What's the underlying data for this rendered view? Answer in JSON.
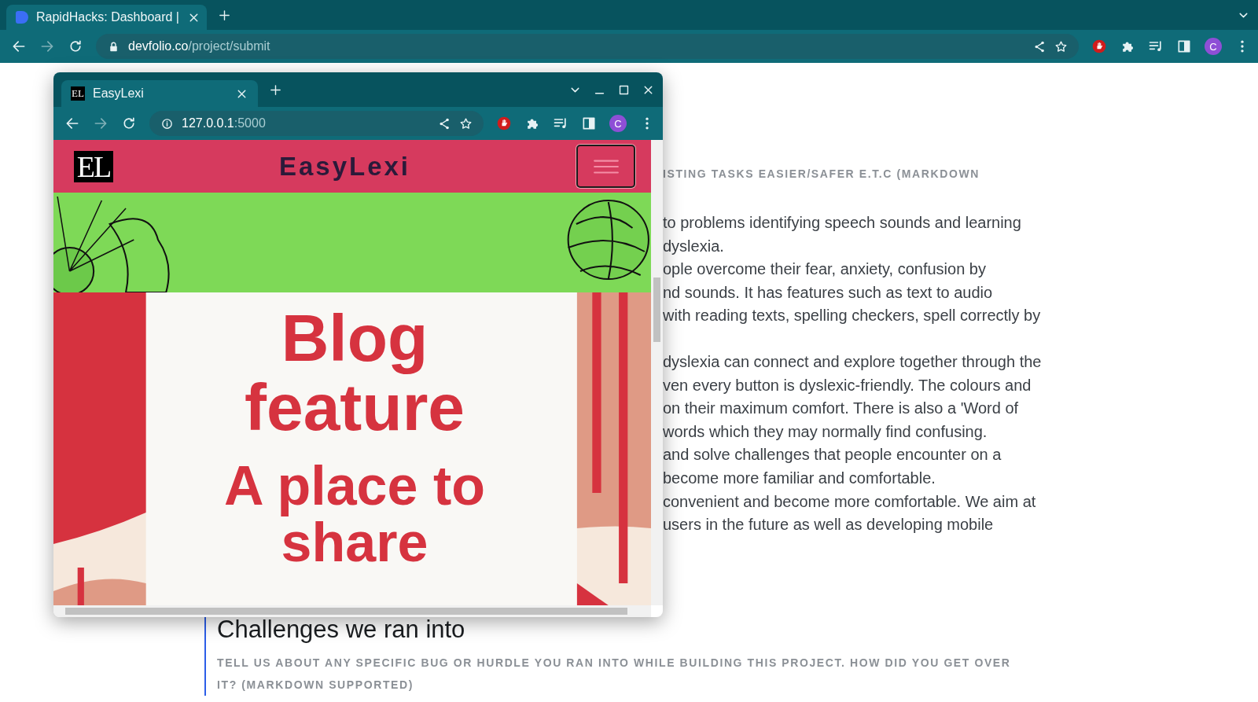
{
  "browser": {
    "tabs": [
      {
        "title": "RapidHacks: Dashboard |",
        "selected": true
      }
    ],
    "url_host": "devfolio.co",
    "url_path": "/project/submit",
    "profile": "C"
  },
  "page": {
    "section_prompt": "ISTING TASKS EASIER/SAFER E.T.C (MARKDOWN",
    "paragraphs": [
      [
        "to problems identifying speech sounds and learning",
        "dyslexia.",
        "ople overcome their fear, anxiety, confusion by",
        "nd sounds. It has features such as text to audio",
        "with reading texts, spelling checkers, spell correctly by"
      ],
      [
        "dyslexia can connect and explore together through the",
        "ven every button is dyslexic-friendly. The colours and",
        "on their maximum comfort. There is also a 'Word of",
        "words which they may normally find confusing.",
        "and solve challenges that people encounter on a",
        "become more familiar and comfortable.",
        "convenient and become more comfortable. We aim at",
        "users in the future as well as developing mobile"
      ]
    ],
    "next_heading": "Challenges we ran into",
    "next_prompt": "TELL US ABOUT ANY SPECIFIC BUG OR HURDLE YOU RAN INTO WHILE BUILDING THIS PROJECT. HOW DID YOU GET OVER IT? (MARKDOWN SUPPORTED)"
  },
  "popup_window": {
    "tabs": [
      {
        "title": "EasyLexi",
        "selected": true
      }
    ],
    "url_host": "127.0.0.1",
    "url_port": ":5000",
    "profile": "C",
    "favicon_text": "EL",
    "site": {
      "logo": "EL",
      "title": "EasyLexi",
      "poster_lines": [
        "Blog",
        "feature",
        "A place to",
        "share"
      ]
    }
  }
}
